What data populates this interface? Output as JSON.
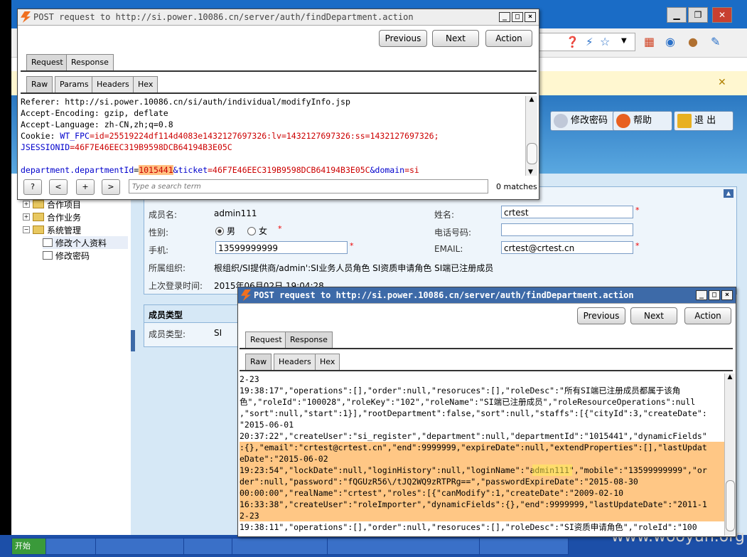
{
  "browser": {
    "infobar_close": "✕",
    "header_buttons": [
      {
        "label": "修改密码"
      },
      {
        "label": "帮助"
      },
      {
        "label": "退 出"
      }
    ],
    "tree": [
      {
        "label": "合作项目"
      },
      {
        "label": "合作业务"
      },
      {
        "label": "系统管理"
      },
      {
        "label": "修改个人资料"
      },
      {
        "label": "修改密码"
      }
    ],
    "form": {
      "member_name_label": "成员名:",
      "member_name_value": "admin111",
      "name_label": "姓名:",
      "name_value": "crtest",
      "gender_label": "性别:",
      "gender_male": "男",
      "gender_female": "女",
      "phone_label": "电话号码:",
      "phone_value": "",
      "mobile_label": "手机:",
      "mobile_value": "13599999999",
      "email_label": "EMAIL:",
      "email_value": "crtest@crtest.cn",
      "org_label": "所属组织:",
      "org_value": "根组织/SI提供商/admin':SI业务人员角色 SI资质申请角色 SI端已注册成员",
      "lastlogin_label": "上次登录时间:",
      "lastlogin_value": "2015年06月02日 19:04:28",
      "section_type": "成员类型",
      "type_label": "成员类型:",
      "type_value": "SI"
    },
    "taskbar": [
      "开始",
      "",
      "",
      "",
      "",
      "",
      "",
      ""
    ],
    "watermark": "www.wooyun.org"
  },
  "dialog1": {
    "title": "POST request to http://si.power.10086.cn/server/auth/findDepartment.action",
    "buttons": {
      "previous": "Previous",
      "next": "Next",
      "action": "Action"
    },
    "tabs": [
      "Request",
      "Response"
    ],
    "subtabs": [
      "Raw",
      "Params",
      "Headers",
      "Hex"
    ],
    "lines": {
      "l1": "Referer: http://si.power.10086.cn/si/auth/individual/modifyInfo.jsp",
      "l2": "Accept-Encoding: gzip, deflate",
      "l3": "Accept-Language: zh-CN,zh;q=0.8",
      "l4_key": "Cookie: ",
      "l4_name": "WT_FPC",
      "l4_val": "=id=25519224df114d4083e1432127697326:lv=1432127697326:ss=1432127697326;",
      "l5_name": "JSESSIONID",
      "l5_val": "=46F7E46EEC319B9598DCB64194B3E05C",
      "l6_p1": "department.departmentId",
      "l6_p2": "=",
      "l6_p3": "1015441",
      "l6_p4": "&ticket",
      "l6_p5": "=46F7E46EEC319B9598DCB64194B3E05C",
      "l6_p6": "&domain",
      "l6_p7": "=si"
    },
    "search_placeholder": "Type a search term",
    "matches": "0 matches",
    "nav": [
      "?",
      "<",
      "+",
      ">"
    ]
  },
  "dialog2": {
    "title": "POST request to http://si.power.10086.cn/server/auth/findDepartment.action",
    "buttons": {
      "previous": "Previous",
      "next": "Next",
      "action": "Action"
    },
    "tabs": [
      "Request",
      "Response"
    ],
    "subtabs": [
      "Raw",
      "Headers",
      "Hex"
    ],
    "lines": [
      "2-23",
      "19:38:17\",\"operations\":[],\"order\":null,\"resoruces\":[],\"roleDesc\":\"所有SI端已注册成员都属于该角",
      "色\",\"roleId\":\"100028\",\"roleKey\":\"102\",\"roleName\":\"SI端已注册成员\",\"roleResourceOperations\":null",
      ",\"sort\":null,\"start\":1}],\"rootDepartment\":false,\"sort\":null,\"staffs\":[{\"cityId\":3,\"createDate\":",
      "\"2015-06-01",
      "20:37:22\",\"createUser\":\"si_register\",\"department\":null,\"departmentId\":\"1015441\",\"dynamicFields\"",
      ":{},\"email\":\"crtest@crtest.cn\",\"end\":9999999,\"expireDate\":null,\"extendProperties\":[],\"lastUpdat",
      "eDate\":\"2015-06-02",
      "19:23:54\",\"lockDate\":null,\"loginHistory\":null,\"loginName\":\"admin111\",\"mobile\":\"13599999999\",\"or",
      "der\":null,\"password\":\"fQGUzR56\\/tJQ2WQ9zRTPRg==\",\"passwordExpireDate\":\"2015-08-30",
      "00:00:00\",\"realName\":\"crtest\",\"roles\":[{\"canModify\":1,\"createDate\":\"2009-02-10",
      "16:33:38\",\"createUser\":\"roleImporter\",\"dynamicFields\":{},\"end\":9999999,\"lastUpdateDate\":\"2011-1",
      "2-23",
      "19:38:11\",\"operations\":[],\"order\":null,\"resoruces\":[],\"roleDesc\":\"SI资质申请角色\",\"roleId\":\"100"
    ]
  }
}
